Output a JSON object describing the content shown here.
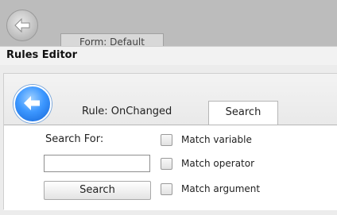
{
  "background_window": {
    "tab_label": "Form: Default",
    "back_icon": "back-arrow-icon"
  },
  "editor": {
    "title": "Rules Editor",
    "back_icon": "back-arrow-icon",
    "rule_label": "Rule: OnChanged",
    "active_tab": "Search"
  },
  "search": {
    "search_for_label": "Search For:",
    "input_value": "",
    "input_placeholder": "",
    "button_label": "Search",
    "options": [
      {
        "label": "Match variable",
        "checked": false
      },
      {
        "label": "Match operator",
        "checked": false
      },
      {
        "label": "Match argument",
        "checked": false
      }
    ]
  },
  "colors": {
    "accent_blue": "#3c97ff",
    "background_gray": "#bcbcbc"
  }
}
